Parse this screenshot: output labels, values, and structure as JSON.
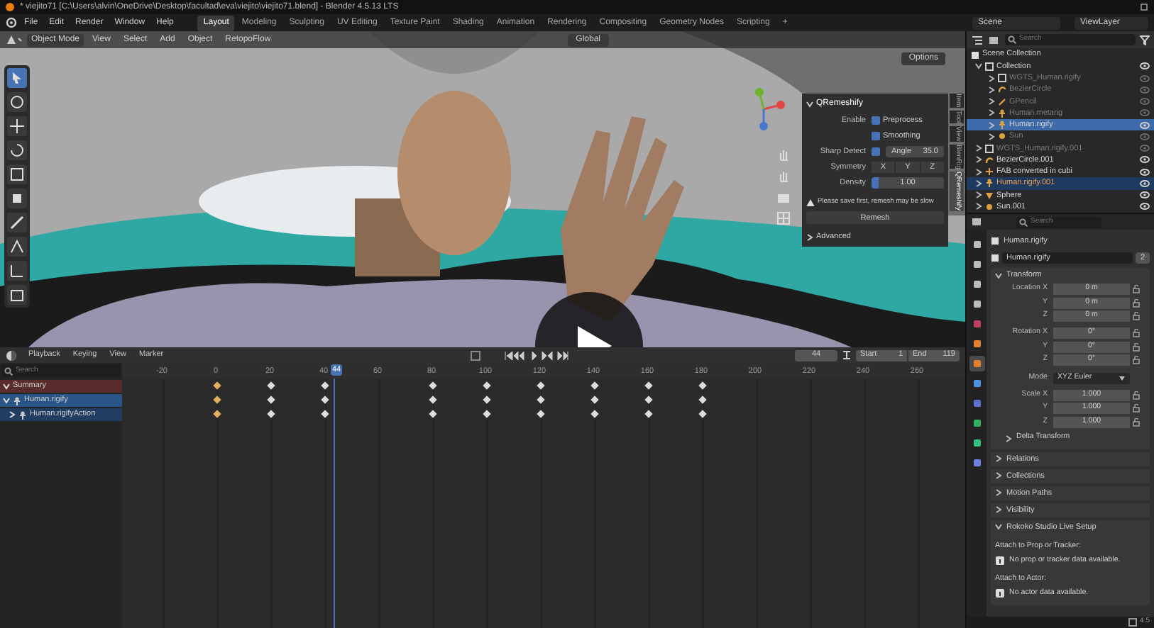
{
  "window": {
    "title": "* viejito71 [C:\\Users\\alvin\\OneDrive\\Desktop\\facultad\\eva\\viejito\\viejito71.blend] - Blender 4.5.13 LTS"
  },
  "menu": [
    "File",
    "Edit",
    "Render",
    "Window",
    "Help"
  ],
  "workspaces": [
    {
      "label": "Layout",
      "selected": true
    },
    {
      "label": "Modeling",
      "selected": false
    },
    {
      "label": "Sculpting",
      "selected": false
    },
    {
      "label": "UV Editing",
      "selected": false
    },
    {
      "label": "Texture Paint",
      "selected": false
    },
    {
      "label": "Shading",
      "selected": false
    },
    {
      "label": "Animation",
      "selected": false
    },
    {
      "label": "Rendering",
      "selected": false
    },
    {
      "label": "Compositing",
      "selected": false
    },
    {
      "label": "Geometry Nodes",
      "selected": false
    },
    {
      "label": "Scripting",
      "selected": false
    },
    {
      "label": "+",
      "selected": false
    }
  ],
  "scene": "Scene",
  "view_layer": "ViewLayer",
  "viewport": {
    "mode": "Object Mode",
    "menus": [
      "View",
      "Select",
      "Add",
      "Object",
      "RetopoFlow"
    ],
    "orientation": "Global",
    "options": "Options",
    "tools": [
      {
        "selected": true
      },
      {
        "selected": false
      },
      {
        "selected": false
      },
      {
        "selected": false
      },
      {
        "selected": false
      },
      {
        "selected": false
      },
      {
        "selected": false
      },
      {
        "selected": false
      },
      {
        "selected": false
      },
      {
        "selected": false
      }
    ],
    "side_tabs": [
      {
        "label": "Item",
        "selected": false
      },
      {
        "label": "Tool",
        "selected": false
      },
      {
        "label": "View",
        "selected": false
      },
      {
        "label": "BlenRig",
        "selected": false
      },
      {
        "label": "QRemeshify",
        "selected": true
      }
    ],
    "qremeshify": {
      "title": "QRemeshify",
      "enable_label": "Enable",
      "options": [
        {
          "label": "Preprocess",
          "checked": true
        },
        {
          "label": "Smoothing",
          "checked": true
        }
      ],
      "sharp_detect": {
        "label": "Sharp Detect",
        "checked": true,
        "field": "Angle",
        "value": "35.0"
      },
      "symmetry": {
        "label": "Symmetry",
        "axes": [
          "X",
          "Y",
          "Z"
        ]
      },
      "density": {
        "label": "Density",
        "value": "1.00",
        "level": 0.1
      },
      "warning": "Please save first, remesh may be slow",
      "button": "Remesh",
      "advanced": "Advanced"
    }
  },
  "timeline": {
    "menus": [
      "Playback",
      "Keying",
      "View",
      "Marker"
    ],
    "current_frame": "44",
    "start_label": "Start",
    "start": "1",
    "end_label": "End",
    "end": "119",
    "search_placeholder": "Search",
    "ruler": [
      {
        "label": "-20",
        "keyframe": false
      },
      {
        "label": "0",
        "keyframe": true
      },
      {
        "label": "20",
        "keyframe": true
      },
      {
        "label": "40",
        "keyframe": true
      },
      {
        "label": "60",
        "keyframe": false
      },
      {
        "label": "80",
        "keyframe": true
      },
      {
        "label": "100",
        "keyframe": true
      },
      {
        "label": "120",
        "keyframe": true
      },
      {
        "label": "140",
        "keyframe": true
      },
      {
        "label": "160",
        "keyframe": true
      },
      {
        "label": "180",
        "keyframe": true
      },
      {
        "label": "200",
        "keyframe": false
      },
      {
        "label": "220",
        "keyframe": false
      },
      {
        "label": "240",
        "keyframe": false
      },
      {
        "label": "260",
        "keyframe": false
      }
    ],
    "playhead": {
      "label": "44",
      "level": 0.251
    },
    "channels": [
      {
        "label": "Summary",
        "kind": "summary"
      },
      {
        "label": "Human.rigify",
        "kind": "object"
      },
      {
        "label": "Human.rigifyAction",
        "kind": "action"
      }
    ]
  },
  "outliner": {
    "search_placeholder": "Search",
    "root": "Scene Collection",
    "items": [
      {
        "label": "Collection",
        "kind": "collection",
        "expanded": true,
        "dim": false,
        "selected": false,
        "active": false,
        "children": [
          {
            "label": "WGTS_Human.rigify",
            "kind": "collection",
            "dim": true,
            "selected": false,
            "active": false
          },
          {
            "label": "BezierCircle",
            "kind": "curve",
            "dim": true,
            "selected": false,
            "active": false
          },
          {
            "label": "GPencil",
            "kind": "pencil",
            "dim": true,
            "selected": false,
            "active": false
          },
          {
            "label": "Human.metarig",
            "kind": "armature",
            "dim": true,
            "selected": false,
            "active": false
          },
          {
            "label": "Human.rigify",
            "kind": "armature",
            "dim": false,
            "selected": true,
            "active": true
          },
          {
            "label": "Sun",
            "kind": "light",
            "dim": true,
            "selected": false,
            "active": false
          }
        ]
      },
      {
        "label": "WGTS_Human.rigify.001",
        "kind": "collection",
        "dim": true,
        "selected": false,
        "active": false
      },
      {
        "label": "BezierCircle.001",
        "kind": "curve",
        "dim": false,
        "selected": false,
        "active": false
      },
      {
        "label": "FAB converted in cubi",
        "kind": "empty",
        "dim": false,
        "selected": false,
        "active": false
      },
      {
        "label": "Human.rigify.001",
        "kind": "armature",
        "dim": false,
        "selected": true,
        "active": false
      },
      {
        "label": "Sphere",
        "kind": "mesh",
        "dim": false,
        "selected": false,
        "active": false
      },
      {
        "label": "Sun.001",
        "kind": "light",
        "dim": false,
        "selected": false,
        "active": false
      }
    ]
  },
  "properties": {
    "search_placeholder": "Search",
    "object_name": "Human.rigify",
    "data_name": "Human.rigify",
    "users": "2",
    "tabs": [
      {
        "selected": false
      },
      {
        "selected": false
      },
      {
        "selected": false
      },
      {
        "selected": false
      },
      {
        "selected": false
      },
      {
        "selected": false
      },
      {
        "selected": true
      },
      {
        "selected": false
      },
      {
        "selected": false
      },
      {
        "selected": false
      },
      {
        "selected": false
      },
      {
        "selected": false
      }
    ],
    "transform": {
      "title": "Transform",
      "expanded": true,
      "rows": [
        {
          "label": "Location X",
          "value": "0 m",
          "kind": "number"
        },
        {
          "label": "Y",
          "value": "0 m",
          "kind": "number"
        },
        {
          "label": "Z",
          "value": "0 m",
          "kind": "number"
        },
        {
          "label": "Rotation X",
          "value": "0°",
          "kind": "number"
        },
        {
          "label": "Y",
          "value": "0°",
          "kind": "number"
        },
        {
          "label": "Z",
          "value": "0°",
          "kind": "number"
        },
        {
          "label": "Mode",
          "value": "XYZ Euler",
          "kind": "dropdown"
        },
        {
          "label": "Scale X",
          "value": "1.000",
          "kind": "number"
        },
        {
          "label": "Y",
          "value": "1.000",
          "kind": "number"
        },
        {
          "label": "Z",
          "value": "1.000",
          "kind": "number"
        }
      ],
      "subpanel": "Delta Transform"
    },
    "panels": [
      {
        "title": "Relations",
        "expanded": false
      },
      {
        "title": "Collections",
        "expanded": false
      },
      {
        "title": "Motion Paths",
        "expanded": false
      },
      {
        "title": "Visibility",
        "expanded": false
      },
      {
        "title": "Rokoko Studio Live Setup",
        "expanded": true,
        "lines": [
          {
            "kind": "label",
            "text": "Attach to Prop or Tracker:"
          },
          {
            "kind": "info",
            "text": "No prop or tracker data available."
          },
          {
            "kind": "label",
            "text": "Attach to Actor:"
          },
          {
            "kind": "info",
            "text": "No actor data available."
          }
        ]
      }
    ]
  },
  "status": {
    "version": "4.5"
  }
}
